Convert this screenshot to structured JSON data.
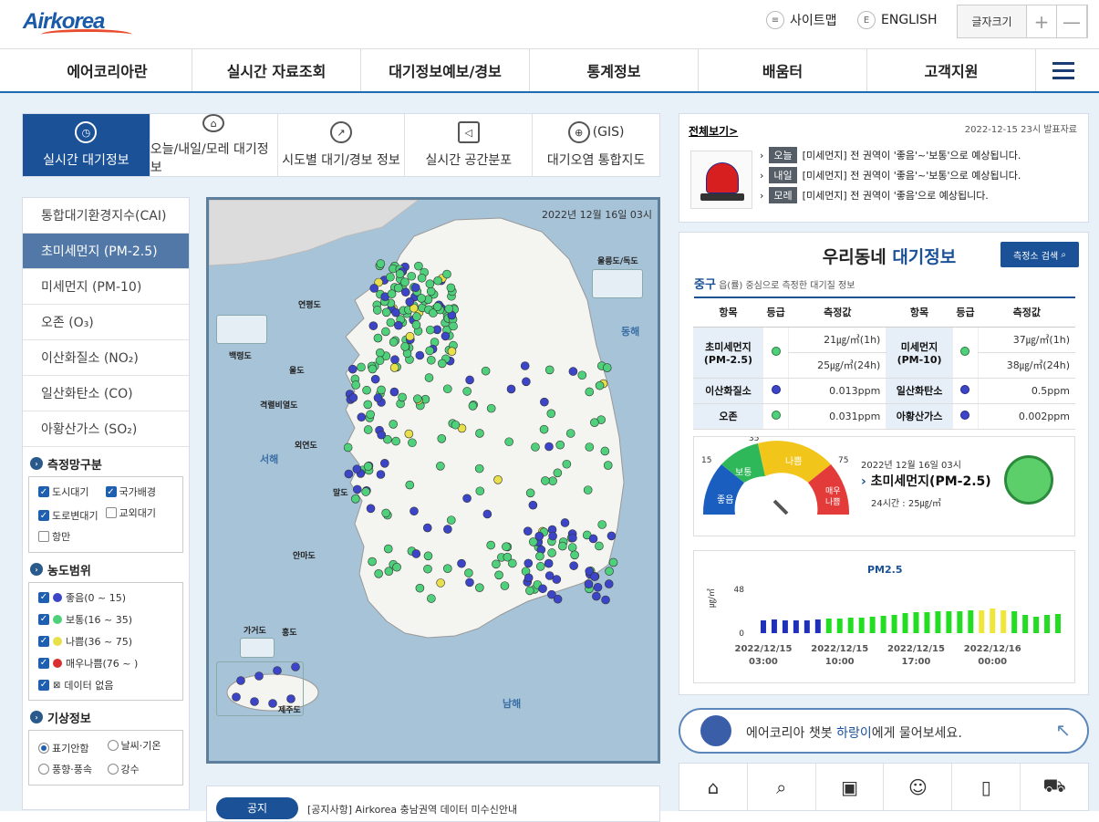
{
  "header": {
    "logo_text": "Airkorea",
    "sitemap": "사이트맵",
    "english_icon": "E",
    "english": "ENGLISH",
    "font_size": "글자크기",
    "font_plus": "+",
    "font_minus": "—"
  },
  "gnb": [
    "에어코리아란",
    "실시간 자료조회",
    "대기정보예보/경보",
    "통계정보",
    "배움터",
    "고객지원"
  ],
  "tabs": [
    {
      "label": "실시간 대기정보",
      "icon": "clock-icon"
    },
    {
      "label": "오늘/내일/모레 대기정보",
      "icon": "forecast-icon"
    },
    {
      "label": "시도별 대기/경보 정보",
      "icon": "compass-icon"
    },
    {
      "label": "실시간 공간분포",
      "icon": "megaphone-icon"
    },
    {
      "label": "대기오염 통합지도",
      "prefix": "(GIS)",
      "icon": "globe-icon"
    }
  ],
  "pollutants": [
    "통합대기환경지수(CAI)",
    "초미세먼지 (PM-2.5)",
    "미세먼지 (PM-10)",
    "오존 (O₃)",
    "이산화질소 (NO₂)",
    "일산화탄소 (CO)",
    "아황산가스 (SO₂)"
  ],
  "network": {
    "title": "측정망구분",
    "items": [
      {
        "label": "도시대기",
        "checked": true
      },
      {
        "label": "국가배경",
        "checked": true
      },
      {
        "label": "도로변대기",
        "checked": true
      },
      {
        "label": "교외대기",
        "checked": false
      },
      {
        "label": "항만",
        "checked": false
      }
    ]
  },
  "range": {
    "title": "농도범위",
    "items": [
      {
        "label": "좋음(0 ~ 15)",
        "color": "#3c45c8"
      },
      {
        "label": "보통(16 ~ 35)",
        "color": "#4fd07a"
      },
      {
        "label": "나쁨(36 ~ 75)",
        "color": "#e8e04a"
      },
      {
        "label": "매우나쁨(76 ~ )",
        "color": "#d83030"
      },
      {
        "label": "데이터 없음",
        "color": "none"
      }
    ]
  },
  "weather": {
    "title": "기상정보",
    "options": [
      {
        "label": "표기안함",
        "selected": true
      },
      {
        "label": "날씨·기온",
        "selected": false
      },
      {
        "label": "풍향·풍속",
        "selected": false
      },
      {
        "label": "강수",
        "selected": false
      }
    ]
  },
  "map": {
    "date": "2022년 12월 16일 03시",
    "labels": {
      "ulleung": "울릉도/독도",
      "donghae": "동해",
      "yeonpyeong": "연평도",
      "baengnyeong": "백령도",
      "ulsan_island": "울도",
      "gyeokryeol": "격렬비열도",
      "seohae": "서해",
      "oeyeon": "외연도",
      "mal": "말도",
      "anma": "안마도",
      "gageo": "가거도",
      "hong": "홍도",
      "jeju": "제주도",
      "namhae": "남해"
    }
  },
  "notice": {
    "button": "공지",
    "text": "[공지사항]  Airkorea 충남권역 데이터 미수신안내"
  },
  "alert": {
    "all": "전체보기>",
    "date": "2022-12-15 23시 발표자료",
    "rows": [
      {
        "day": "오늘",
        "text": "[미세먼지] 전 권역이 '좋음'~'보통'으로 예상됩니다."
      },
      {
        "day": "내일",
        "text": "[미세먼지] 전 권역이 '좋음'~'보통'으로 예상됩니다."
      },
      {
        "day": "모레",
        "text": "[미세먼지] 전 권역이 '좋음'으로 예상됩니다."
      }
    ]
  },
  "dong": {
    "title_a": "우리동네 ",
    "title_b": "대기정보",
    "search": "측정소 검색",
    "district": "중구",
    "district_desc": " 읍(률) 중심으로 측정한 대기질 정보",
    "headers": [
      "항목",
      "등급",
      "측정값",
      "항목",
      "등급",
      "측정값"
    ],
    "rows": [
      {
        "name": "초미세먼지\n(PM-2.5)",
        "v1": "21㎍/㎥(1h)",
        "v2": "25㎍/㎥(24h)",
        "name2": "미세먼지\n(PM-10)",
        "w1": "37㎍/㎥(1h)",
        "w2": "38㎍/㎥(24h)"
      },
      {
        "name": "이산화질소",
        "v": "0.013ppm",
        "name2": "일산화탄소",
        "w": "0.5ppm"
      },
      {
        "name": "오존",
        "v": "0.031ppm",
        "name2": "아황산가스",
        "w": "0.002ppm"
      }
    ]
  },
  "gauge": {
    "date": "2022년 12월 16일 03시",
    "title": "초미세먼지(PM-2.5)",
    "sub": "24시간 : 25㎍/㎥",
    "ticks": [
      "15",
      "35",
      "75"
    ],
    "bands": [
      "좋음",
      "보통",
      "나쁨",
      "매우\n나쁨"
    ]
  },
  "chart_data": {
    "type": "bar",
    "title": "PM2.5",
    "ylabel": "㎍/㎥",
    "ylim": [
      0,
      60
    ],
    "yticks": [
      0,
      48
    ],
    "xticks": [
      "2022/12/15\n03:00",
      "2022/12/15\n10:00",
      "2022/12/15\n17:00",
      "2022/12/16\n00:00"
    ],
    "values": [
      14,
      15,
      14,
      14,
      14,
      15,
      16,
      16,
      17,
      17,
      18,
      19,
      20,
      22,
      23,
      23,
      24,
      24,
      24,
      25,
      25,
      27,
      25,
      24,
      20,
      18,
      20,
      21
    ]
  },
  "chat": {
    "pre": "에어코리아 챗봇 ",
    "name": "하랑이",
    "post": "에게 물어보세요."
  },
  "quick_icons": [
    "home-icon",
    "search-doc-icon",
    "monitor-icon",
    "people-icon",
    "mobile-icon",
    "car-icon"
  ]
}
